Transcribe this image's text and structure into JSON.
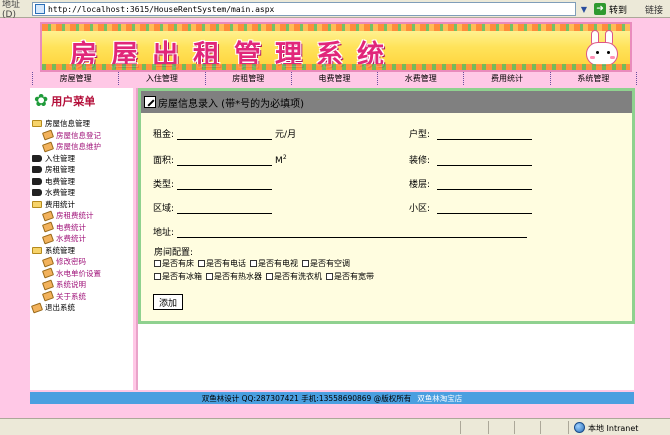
{
  "browser": {
    "address_label": "地址(D)",
    "url": "http://localhost:3615/HouseRentSystem/main.aspx",
    "go_label": "转到",
    "links_label": "链接",
    "status_zone": "本地 Intranet"
  },
  "banner": {
    "title": "房屋出租管理系统"
  },
  "nav": [
    "房屋管理",
    "入住管理",
    "房租管理",
    "电费管理",
    "水费管理",
    "费用统计",
    "系统管理"
  ],
  "sidebar": {
    "title": "用户菜单",
    "items": [
      {
        "label": "房屋信息管理",
        "level": 0,
        "icon": "folder-icon"
      },
      {
        "label": "房屋信息登记",
        "level": 1,
        "icon": "doc-icon"
      },
      {
        "label": "房屋信息维护",
        "level": 1,
        "icon": "doc-icon"
      },
      {
        "label": "入住管理",
        "level": 0,
        "icon": "book-icon"
      },
      {
        "label": "房租管理",
        "level": 0,
        "icon": "book-icon"
      },
      {
        "label": "电费管理",
        "level": 0,
        "icon": "book-icon"
      },
      {
        "label": "水费管理",
        "level": 0,
        "icon": "book-icon"
      },
      {
        "label": "费用统计",
        "level": 0,
        "icon": "folder-icon"
      },
      {
        "label": "房租费统计",
        "level": 1,
        "icon": "doc-icon"
      },
      {
        "label": "电费统计",
        "level": 1,
        "icon": "doc-icon"
      },
      {
        "label": "水费统计",
        "level": 1,
        "icon": "doc-icon"
      },
      {
        "label": "系统管理",
        "level": 0,
        "icon": "folder-icon"
      },
      {
        "label": "修改密码",
        "level": 1,
        "icon": "doc-icon"
      },
      {
        "label": "水电单价设置",
        "level": 1,
        "icon": "doc-icon"
      },
      {
        "label": "系统说明",
        "level": 1,
        "icon": "doc-icon"
      },
      {
        "label": "关于系统",
        "level": 1,
        "icon": "doc-icon"
      },
      {
        "label": "退出系统",
        "level": 0,
        "icon": "doc-icon"
      }
    ]
  },
  "form": {
    "title": "房屋信息录入 (带*号的为必填项)",
    "rent_label": "租金:",
    "rent_unit": "元/月",
    "type_label": "户型:",
    "area_label": "面积:",
    "area_unit": "M",
    "area_unit_sup": "2",
    "decor_label": "装修:",
    "category_label": "类型:",
    "floor_label": "楼层:",
    "district_label": "区域:",
    "community_label": "小区:",
    "address_label": "地址:",
    "config_label": "房间配置:",
    "checks_row1": [
      "是否有床",
      "是否有电话",
      "是否有电视",
      "是否有空调"
    ],
    "checks_row2": [
      "是否有冰箱",
      "是否有热水器",
      "是否有洗衣机",
      "是否有宽带"
    ],
    "submit_label": "添加"
  },
  "footer": {
    "text": "双鱼林设计 QQ:287307421 手机:13558690869 @版权所有",
    "shop": "双鱼林淘宝店"
  }
}
